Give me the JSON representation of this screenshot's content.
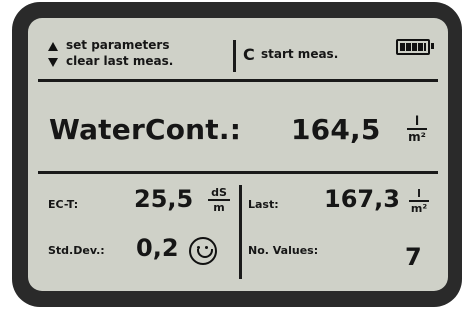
{
  "header": {
    "set_parameters": "set parameters",
    "clear_last": "clear last meas.",
    "start_meas": "start meas.",
    "refresh_symbol": "C"
  },
  "main": {
    "label": "WaterCont.:",
    "value": "164,5",
    "unit": {
      "num": "l",
      "den": "m²"
    }
  },
  "left": {
    "ec_label": "EC-T:",
    "ec_value": "25,5",
    "ec_unit": {
      "num": "dS",
      "den": "m"
    },
    "std_label": "Std.Dev.:",
    "std_value": "0,2"
  },
  "right": {
    "last_label": "Last:",
    "last_value": "167,3",
    "last_unit": {
      "num": "l",
      "den": "m²"
    },
    "count_label": "No. Values:",
    "count_value": "7"
  },
  "icons": {
    "up": "triangle-up-icon",
    "down": "triangle-down-icon",
    "refresh": "refresh-icon",
    "battery": "battery-full-icon",
    "smiley": "smiley-icon"
  },
  "colors": {
    "screen_bg": "#cfd1c8",
    "bezel": "#2a2a2a",
    "ink": "#161616"
  }
}
